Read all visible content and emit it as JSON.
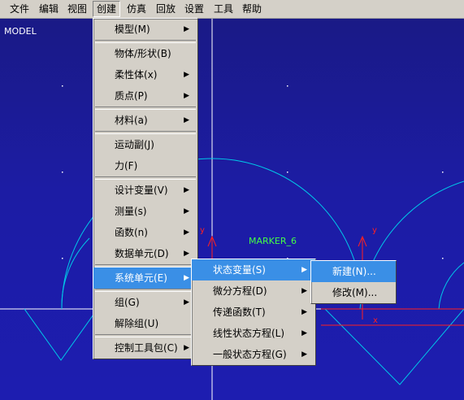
{
  "menubar": [
    "文件",
    "编辑",
    "视图",
    "创建",
    "仿真",
    "回放",
    "设置",
    "工具",
    "帮助"
  ],
  "viewport": {
    "model_label": "MODEL",
    "marker_label": "MARKER_6",
    "axis_labels": [
      "y",
      "y",
      "x"
    ]
  },
  "create_menu": [
    {
      "label": "模型(M)",
      "submenu": true
    },
    {
      "sep": true
    },
    {
      "label": "物体/形状(B)",
      "submenu": false
    },
    {
      "label": "柔性体(x)",
      "submenu": true
    },
    {
      "label": "质点(P)",
      "submenu": true
    },
    {
      "sep": true
    },
    {
      "label": "材料(a)",
      "submenu": true
    },
    {
      "sep": true
    },
    {
      "label": "运动副(J)",
      "submenu": false
    },
    {
      "label": "力(F)",
      "submenu": false
    },
    {
      "sep": true
    },
    {
      "label": "设计变量(V)",
      "submenu": true
    },
    {
      "label": "测量(s)",
      "submenu": true
    },
    {
      "label": "函数(n)",
      "submenu": true
    },
    {
      "label": "数据单元(D)",
      "submenu": true
    },
    {
      "sep": true
    },
    {
      "label": "系统单元(E)",
      "submenu": true,
      "highlighted": true
    },
    {
      "sep": true
    },
    {
      "label": "组(G)",
      "submenu": true
    },
    {
      "label": "解除组(U)",
      "submenu": false
    },
    {
      "sep": true
    },
    {
      "label": "控制工具包(C)",
      "submenu": true
    }
  ],
  "system_menu": [
    {
      "label": "状态变量(S)",
      "submenu": true,
      "highlighted": true
    },
    {
      "label": "微分方程(D)",
      "submenu": true
    },
    {
      "label": "传递函数(T)",
      "submenu": true
    },
    {
      "label": "线性状态方程(L)",
      "submenu": true
    },
    {
      "label": "一般状态方程(G)",
      "submenu": true
    }
  ],
  "state_menu": [
    {
      "label": "新建(N)...",
      "highlighted": true
    },
    {
      "label": "修改(M)..."
    }
  ],
  "colors": {
    "highlight": "#3a8fe6",
    "menu_bg": "#d4d0c8",
    "geometry": "#00c8e8",
    "marker_axis": "#ff2020",
    "marker_label": "#44ff44"
  }
}
